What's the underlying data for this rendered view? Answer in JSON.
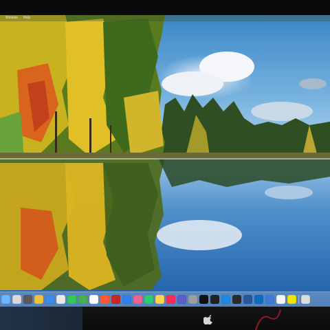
{
  "menubar": {
    "items": [
      "Window",
      "Help"
    ]
  },
  "wallpaper": {
    "description_icon": "autumn-lake-wallpaper"
  },
  "dock": {
    "apps": [
      {
        "name": "finder-icon",
        "color": "#6fb5ff"
      },
      {
        "name": "launchpad-icon",
        "color": "#d9d9d9"
      },
      {
        "name": "calculator-icon",
        "color": "#5a5a5a"
      },
      {
        "name": "photos-icon",
        "color": "#f0c040"
      },
      {
        "name": "safari-icon",
        "color": "#3b8de8"
      },
      {
        "name": "camera-icon",
        "color": "#e9e9e9"
      },
      {
        "name": "messages-icon",
        "color": "#35c759"
      },
      {
        "name": "chrome-icon",
        "color": "#4caf50"
      },
      {
        "name": "calendar-icon",
        "color": "#ffffff"
      },
      {
        "name": "settings-icon",
        "color": "#ff5a36"
      },
      {
        "name": "dictionary-icon",
        "color": "#c62828"
      },
      {
        "name": "mail-icon",
        "color": "#2f80ed"
      },
      {
        "name": "preview-icon",
        "color": "#f06292"
      },
      {
        "name": "facetime-icon",
        "color": "#2ecc71"
      },
      {
        "name": "notes-icon",
        "color": "#ffd54f"
      },
      {
        "name": "music-icon",
        "color": "#fa2d55"
      },
      {
        "name": "teams-icon",
        "color": "#5b5fc7"
      },
      {
        "name": "system-settings-icon",
        "color": "#9e9e9e"
      },
      {
        "name": "chatgpt-icon",
        "color": "#111111"
      },
      {
        "name": "capcut-icon",
        "color": "#222222"
      },
      {
        "name": "xcode-icon",
        "color": "#1e88e5"
      },
      {
        "name": "terminal-icon",
        "color": "#2b2b2b"
      },
      {
        "name": "word-icon",
        "color": "#2b579a"
      },
      {
        "name": "outlook-icon",
        "color": "#0f6cbd"
      },
      {
        "name": "finder-alt-icon",
        "color": "#3d7bd9"
      },
      {
        "name": "notion-icon",
        "color": "#f5f5f5"
      },
      {
        "name": "stickies-icon",
        "color": "#f2e600"
      },
      {
        "name": "trash-icon",
        "color": "#dcdcdc"
      }
    ]
  }
}
